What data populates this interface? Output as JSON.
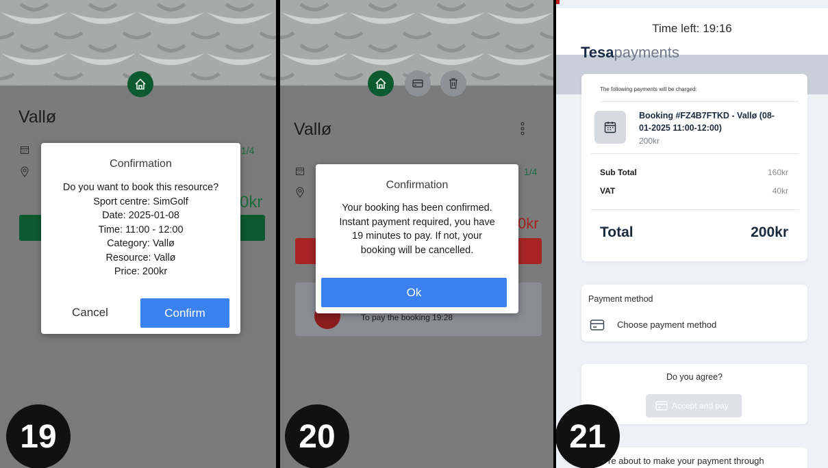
{
  "screen19": {
    "title": "Vallø",
    "spots": "1/4",
    "price_partial": "0kr",
    "dialog": {
      "title": "Confirmation",
      "lines": [
        "Do you want to book this resource?",
        "Sport centre: SimGolf",
        "Date: 2025-01-08",
        "Time: 11:00 - 12:00",
        "Category: Vallø",
        "Resource: Vallø",
        "Price: 200kr"
      ],
      "cancel_label": "Cancel",
      "confirm_label": "Confirm"
    },
    "step": "19"
  },
  "screen20": {
    "title": "Vallø",
    "spots": "1/4",
    "price_partial": "0kr",
    "pay_notice": "To pay the booking 19:28",
    "dialog": {
      "title": "Confirmation",
      "lines": [
        "Your booking has been confirmed.",
        "Instant payment required, you have",
        "19 minutes to pay. If not, your",
        "booking will be cancelled."
      ],
      "ok_label": "Ok"
    },
    "step": "20"
  },
  "screen21": {
    "time_left": "Time left: 19:16",
    "brand_bold": "Tesa",
    "brand_light": "payments",
    "charged_header": "The following payments will be charged:",
    "booking_line1": "Booking #FZ4B7FTKD - Vallø (08-",
    "booking_line2": "01-2025 11:00-12:00)",
    "booking_price": "200kr",
    "subtotal_label": "Sub Total",
    "subtotal_value": "160kr",
    "vat_label": "VAT",
    "vat_value": "40kr",
    "total_label": "Total",
    "total_value": "200kr",
    "payment_method_label": "Payment method",
    "choose_method": "Choose payment method",
    "agree_question": "Do you agree?",
    "accept_pay": "Accept and pay",
    "bottom_partial": "re about to make your payment through",
    "step": "21"
  },
  "colors": {
    "green": "#0d5a30",
    "blue": "#3b82f0",
    "navy": "#1a2b45"
  },
  "icons": {
    "home": "home-icon",
    "card": "card-icon",
    "trash": "trash-icon",
    "calendar": "calendar-icon",
    "location": "location-pin-icon",
    "more": "more-vertical-icon"
  }
}
